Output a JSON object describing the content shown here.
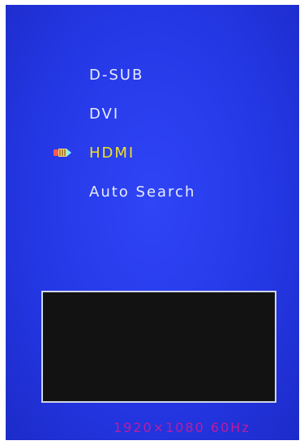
{
  "osd": {
    "source_menu": {
      "items": [
        {
          "label": "D-SUB",
          "selected": false
        },
        {
          "label": "DVI",
          "selected": false
        },
        {
          "label": "HDMI",
          "selected": true
        },
        {
          "label": "Auto Search",
          "selected": false
        }
      ],
      "selector_icon": "pencil-icon"
    },
    "status": {
      "resolution_text": "1920×1080 60Hz"
    },
    "colors": {
      "background": "#2538e6",
      "item_text": "#e8ecff",
      "selected_text": "#f4e21d",
      "status_text": "#c01a9e",
      "preview_bg": "#121212"
    }
  }
}
